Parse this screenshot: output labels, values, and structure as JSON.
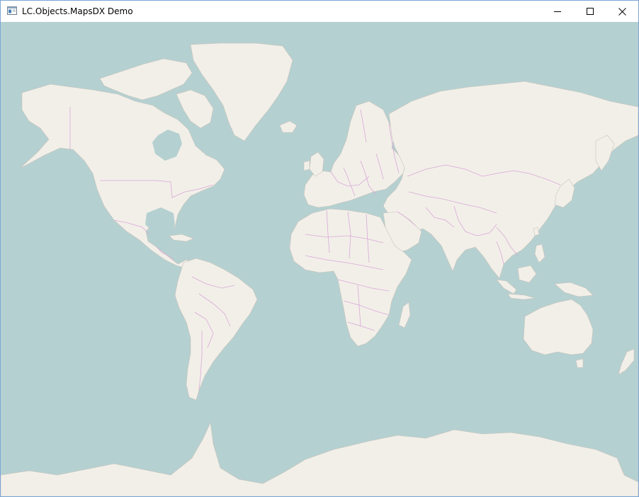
{
  "window": {
    "title": "LC.Objects.MapsDX Demo",
    "icons": {
      "app": "app-window-icon",
      "minimize": "minimize-icon",
      "maximize": "maximize-icon",
      "close": "close-icon"
    }
  },
  "map": {
    "colors": {
      "ocean": "#b5d0d0",
      "land": "#f2efe9",
      "border": "#d9a8d6",
      "coast": "#c9c4bc"
    }
  }
}
